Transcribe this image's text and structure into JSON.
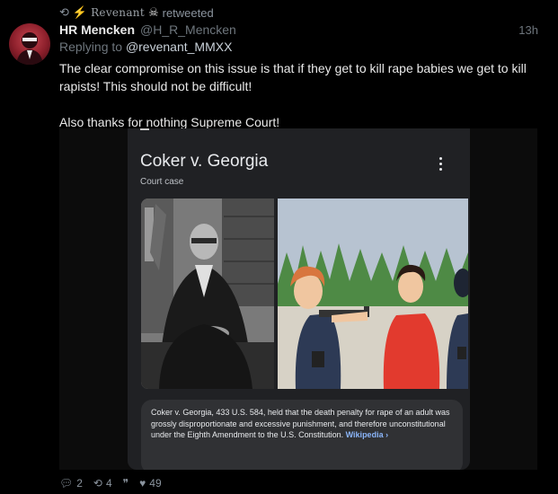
{
  "retweet": {
    "retweeter_name": "Revenant",
    "suffix": "retweeted"
  },
  "tweet": {
    "display_name": "HR Mencken",
    "handle": "@H_R_Mencken",
    "time": "13h",
    "replying_prefix": "Replying to ",
    "replying_to": "@revenant_MMXX",
    "text": "The clear compromise on this issue is that if they get to kill rape babies we get to kill rapists! This should not be difficult!\n\nAlso thanks for nothing Supreme Court!"
  },
  "card": {
    "title": "Coker v. Georgia",
    "subtitle": "Court case",
    "summary": "Coker v. Georgia, 433 U.S. 584, held that the death penalty for rape of an adult was grossly disproportionate and excessive punishment, and therefore unconstitutional under the Eighth Amendment to the U.S. Constitution. ",
    "source_link": "Wikipedia ›"
  },
  "actions": {
    "replies": "2",
    "retweets": "4",
    "quotes_icon": "quote-icon",
    "likes": "49"
  },
  "colors": {
    "background": "#000000",
    "muted": "#6e767d",
    "link": "#8ab4f8",
    "bolt": "#f6c026"
  }
}
